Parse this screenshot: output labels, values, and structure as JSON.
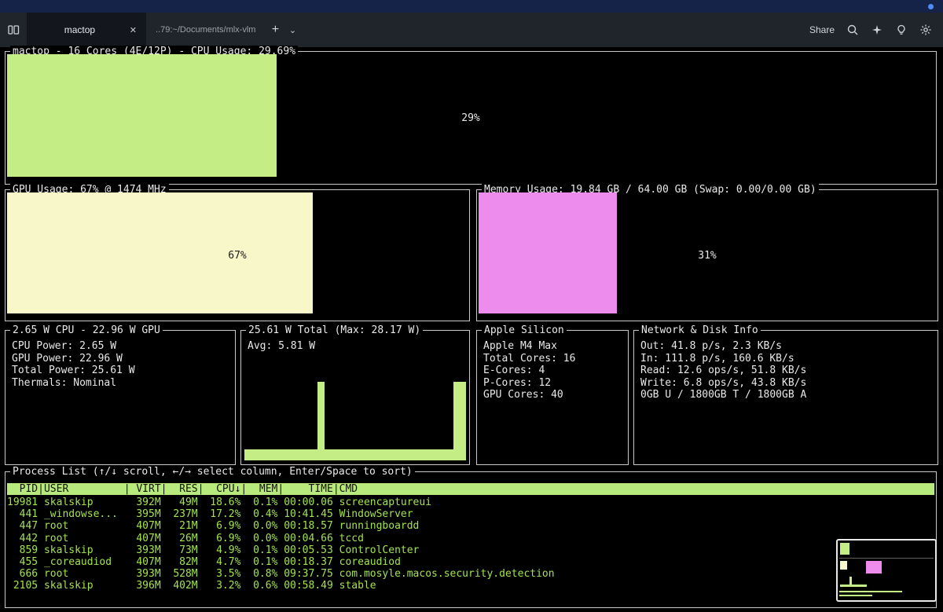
{
  "colors": {
    "green": "#c4ee85",
    "yellow": "#f7f7c9",
    "magenta": "#ee8cee",
    "border": "#c9c9c9",
    "text": "#e9e9e9",
    "process_text": "#a3e14f",
    "header_bg": "#b7e97c",
    "titlebar": "#152349",
    "tabbar": "#20252c",
    "accent_dot": "#4f8cf7"
  },
  "tabbar": {
    "tabs": [
      {
        "label": "mactop"
      },
      {
        "label": "..79:~/Documents/mlx-vlm"
      }
    ],
    "new_tab_glyph": "+",
    "chevron_glyph": "⌄",
    "close_glyph": "✕",
    "share_label": "Share"
  },
  "panels": {
    "cpu": {
      "title": "mactop - 16 Cores (4E/12P) - CPU Usage: 29.69%",
      "bar_percent": 29,
      "label": "29%",
      "color": "#c4ee85",
      "label_color": "#e9e9e9"
    },
    "gpu": {
      "title": "GPU Usage: 67% @ 1474 MHz",
      "bar_percent": 66,
      "label": "67%",
      "color": "#f7f7c9",
      "label_color": "#1c1c1c"
    },
    "memory": {
      "title": "Memory Usage: 19.84 GB / 64.00 GB (Swap: 0.00/0.00 GB)",
      "bar_percent": 30,
      "label": "31%",
      "color": "#ee8cee",
      "label_color": "#e9e9e9"
    },
    "power": {
      "title": "2.65 W CPU - 22.96 W GPU",
      "lines": [
        "CPU Power: 2.65 W",
        "GPU Power: 22.96 W",
        "Total Power: 25.61 W",
        "Thermals: Nominal"
      ]
    },
    "total_power": {
      "title": "25.61 W Total (Max: 28.17 W)",
      "avg": "Avg: 5.81 W",
      "chart": {
        "baseline_height_px": 14,
        "spikes": [
          {
            "x": 33,
            "w": 3,
            "h": 80
          },
          {
            "x": 94.5,
            "w": 5.5,
            "h": 80
          }
        ]
      }
    },
    "silicon": {
      "title": "Apple Silicon",
      "lines": [
        "Apple M4 Max",
        "Total Cores: 16",
        "E-Cores: 4",
        "P-Cores: 12",
        "GPU Cores: 40"
      ]
    },
    "network": {
      "title": "Network & Disk Info",
      "lines": [
        "Out: 41.8 p/s, 2.3 KB/s",
        "In: 111.8 p/s, 160.6 KB/s",
        "Read: 12.6 ops/s, 51.8 KB/s",
        "Write: 6.8 ops/s, 43.8 KB/s",
        "0GB U / 1800GB T / 1800GB A"
      ]
    },
    "process": {
      "title": "Process List (↑/↓ scroll, ←/→ select column, Enter/Space to sort)",
      "columns": [
        {
          "label": "PID",
          "width": 5,
          "align": "right"
        },
        {
          "label": "USER",
          "width": 13,
          "align": "left"
        },
        {
          "label": "VIRT",
          "width": 5,
          "align": "right"
        },
        {
          "label": "RES",
          "width": 5,
          "align": "right"
        },
        {
          "label": "CPU↓",
          "width": 6,
          "align": "right"
        },
        {
          "label": "MEM",
          "width": 5,
          "align": "right"
        },
        {
          "label": "TIME",
          "width": 8,
          "align": "right"
        },
        {
          "label": "CMD",
          "width": 0,
          "align": "left"
        }
      ],
      "rows": [
        [
          "19981",
          "skalskip",
          "392M",
          "49M",
          "18.6%",
          "0.1%",
          "00:00.06",
          "screencaptureui"
        ],
        [
          "441",
          "_windowse...",
          "395M",
          "237M",
          "17.2%",
          "0.4%",
          "10:41.45",
          "WindowServer"
        ],
        [
          "447",
          "root",
          "407M",
          "21M",
          "6.9%",
          "0.0%",
          "00:18.57",
          "runningboardd"
        ],
        [
          "442",
          "root",
          "407M",
          "26M",
          "6.9%",
          "0.0%",
          "00:04.66",
          "tccd"
        ],
        [
          "859",
          "skalskip",
          "393M",
          "73M",
          "4.9%",
          "0.1%",
          "00:05.53",
          "ControlCenter"
        ],
        [
          "455",
          "_coreaudiod",
          "407M",
          "82M",
          "4.7%",
          "0.1%",
          "00:18.37",
          "coreaudiod"
        ],
        [
          "666",
          "root",
          "393M",
          "528M",
          "3.5%",
          "0.8%",
          "09:37.75",
          "com.mosyle.macos.security.detection"
        ],
        [
          "2105",
          "skalskip",
          "396M",
          "402M",
          "3.2%",
          "0.6%",
          "00:58.49",
          "stable"
        ]
      ]
    }
  }
}
